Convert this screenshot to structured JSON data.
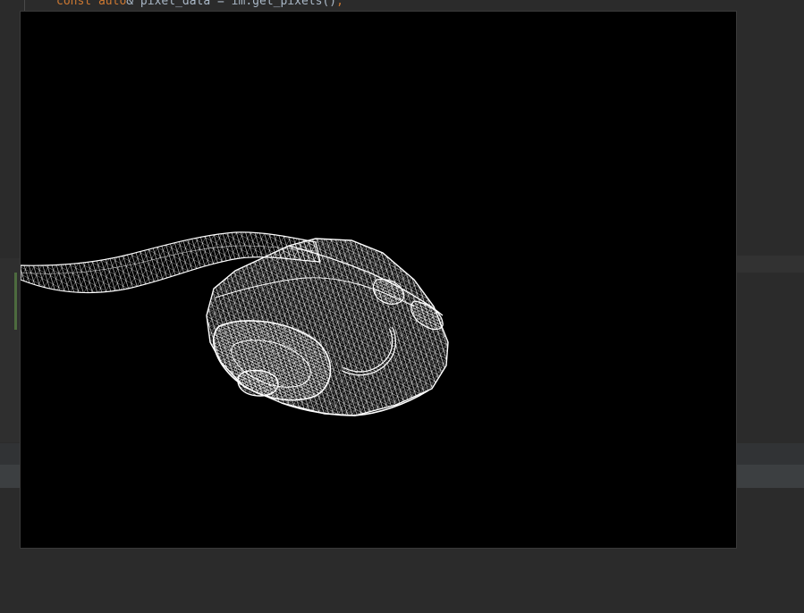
{
  "editor": {
    "code_keyword": "const",
    "code_type": "auto",
    "code_rest": "& pixel_data = im.get_pixels()",
    "code_semicolon": ";"
  },
  "render": {
    "background": "#000000",
    "wire_color": "#ffffff"
  }
}
